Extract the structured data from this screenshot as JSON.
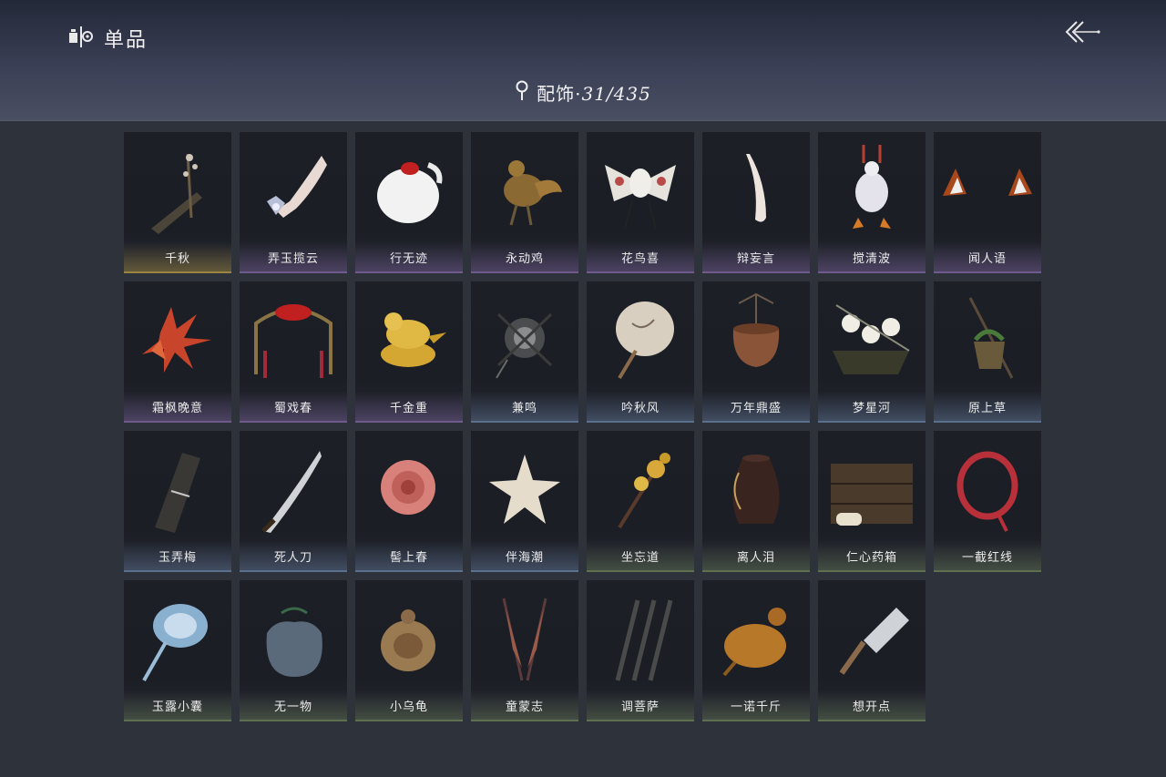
{
  "header": {
    "title": "单品"
  },
  "category": {
    "name": "配饰",
    "separator": "·",
    "count": "31/435"
  },
  "colors": {
    "gold": "#9a8540",
    "purple": "#6f5a8c",
    "blue": "#5a6f8c",
    "green": "#5f7050"
  },
  "items": [
    {
      "label": "千秋",
      "rarity": "gold",
      "icon": "zither-icon"
    },
    {
      "label": "弄玉揽云",
      "rarity": "purple",
      "icon": "jeweled-hand-icon"
    },
    {
      "label": "行无迹",
      "rarity": "purple",
      "icon": "cat-paw-icon"
    },
    {
      "label": "永动鸡",
      "rarity": "purple",
      "icon": "mechanical-rooster-icon"
    },
    {
      "label": "花鸟喜",
      "rarity": "purple",
      "icon": "bird-kite-icon"
    },
    {
      "label": "辩妄言",
      "rarity": "purple",
      "icon": "white-feather-icon"
    },
    {
      "label": "搅清波",
      "rarity": "purple",
      "icon": "duck-puppet-icon"
    },
    {
      "label": "闻人语",
      "rarity": "purple",
      "icon": "fox-ears-icon"
    },
    {
      "label": "霜枫晚意",
      "rarity": "purple",
      "icon": "maple-leaves-icon"
    },
    {
      "label": "蜀戏春",
      "rarity": "purple",
      "icon": "opera-headdress-icon"
    },
    {
      "label": "千金重",
      "rarity": "purple",
      "icon": "golden-bird-icon"
    },
    {
      "label": "兼鸣",
      "rarity": "blue",
      "icon": "pinwheel-icon"
    },
    {
      "label": "吟秋风",
      "rarity": "blue",
      "icon": "round-fan-icon"
    },
    {
      "label": "万年鼎盛",
      "rarity": "blue",
      "icon": "cauldron-icon"
    },
    {
      "label": "梦星河",
      "rarity": "blue",
      "icon": "flower-swing-icon"
    },
    {
      "label": "原上草",
      "rarity": "blue",
      "icon": "grass-basket-icon"
    },
    {
      "label": "玉弄梅",
      "rarity": "blue",
      "icon": "instrument-case-icon"
    },
    {
      "label": "死人刀",
      "rarity": "blue",
      "icon": "saber-icon"
    },
    {
      "label": "髻上春",
      "rarity": "blue",
      "icon": "hair-flower-icon"
    },
    {
      "label": "伴海潮",
      "rarity": "blue",
      "icon": "starfish-icon"
    },
    {
      "label": "坐忘道",
      "rarity": "green",
      "icon": "gold-hairpin-icon"
    },
    {
      "label": "离人泪",
      "rarity": "green",
      "icon": "wine-jar-icon"
    },
    {
      "label": "仁心药箱",
      "rarity": "green",
      "icon": "medicine-box-icon"
    },
    {
      "label": "一截红线",
      "rarity": "green",
      "icon": "red-cord-icon"
    },
    {
      "label": "玉露小囊",
      "rarity": "green",
      "icon": "blue-pouch-icon"
    },
    {
      "label": "无一物",
      "rarity": "green",
      "icon": "cloth-bag-icon"
    },
    {
      "label": "小乌龟",
      "rarity": "green",
      "icon": "tortoise-icon"
    },
    {
      "label": "童蒙志",
      "rarity": "green",
      "icon": "pennant-flags-icon"
    },
    {
      "label": "调菩萨",
      "rarity": "green",
      "icon": "darts-icon"
    },
    {
      "label": "一诺千斤",
      "rarity": "green",
      "icon": "roast-chicken-icon"
    },
    {
      "label": "想开点",
      "rarity": "green",
      "icon": "cleaver-icon"
    }
  ]
}
